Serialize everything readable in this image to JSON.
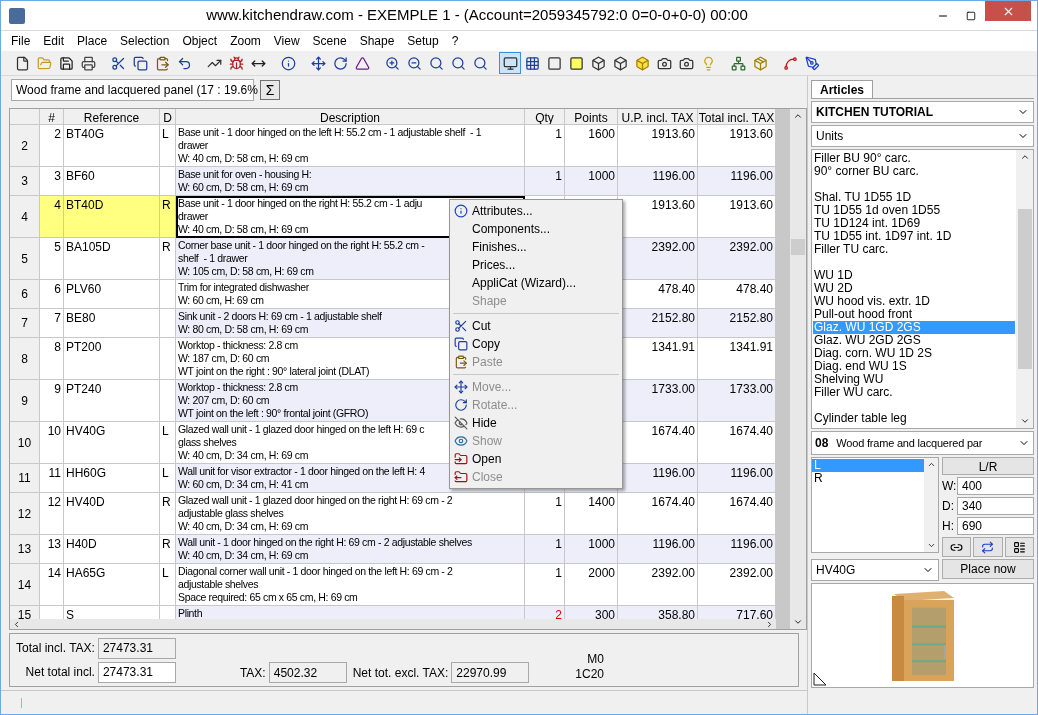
{
  "window": {
    "title": "www.kitchendraw.com - EXEMPLE 1 - (Account=2059345792:0 0=0-0+0-0) 00:00"
  },
  "menu": [
    "File",
    "Edit",
    "Place",
    "Selection",
    "Object",
    "Zoom",
    "View",
    "Scene",
    "Shape",
    "Setup",
    "?"
  ],
  "toolbar": [
    {
      "selected": false
    },
    {
      "selected": false
    },
    {
      "selected": false
    },
    {
      "selected": false
    },
    {
      "selected": false
    },
    {
      "selected": false
    },
    {
      "selected": false
    },
    {
      "selected": false
    },
    {
      "selected": false
    },
    {
      "selected": false
    },
    {
      "selected": false
    },
    {
      "selected": false
    },
    {
      "selected": false
    },
    {
      "selected": false
    },
    {
      "selected": false
    },
    {
      "selected": false
    },
    {
      "selected": false
    },
    {
      "selected": false
    },
    {
      "selected": false
    },
    {
      "selected": false
    },
    {
      "selected": true
    },
    {
      "selected": false
    },
    {
      "selected": false
    },
    {
      "selected": false
    },
    {
      "selected": false
    },
    {
      "selected": false
    },
    {
      "selected": false
    },
    {
      "selected": false
    },
    {
      "selected": false
    },
    {
      "selected": false
    },
    {
      "selected": false
    },
    {
      "selected": false
    },
    {
      "selected": false
    },
    {
      "selected": false
    }
  ],
  "finish_select": {
    "value": "Wood frame and lacquered panel (17 : 19.6%"
  },
  "sum_button": "Σ",
  "table": {
    "columns": [
      "#",
      "Reference",
      "D",
      "Description",
      "Qty",
      "Points",
      "U.P. incl. TAX",
      "Total incl. TAX"
    ],
    "rows": [
      {
        "header": "2",
        "num": "2",
        "ref": "BT40G",
        "d": "L",
        "desc": [
          "Base unit - 1 door hinged on the left H: 55.2 cm - 1 adjustable shelf  - 1",
          "drawer",
          "W: 40 cm, D: 58 cm, H: 69 cm"
        ],
        "qty": "1",
        "points": "1600",
        "up": "1913.60",
        "total": "1913.60",
        "selected": false,
        "qty_alert": false
      },
      {
        "header": "3",
        "num": "3",
        "ref": "BF60",
        "d": "",
        "desc": [
          "Base unit for oven - housing H:",
          "W: 60 cm, D: 58 cm, H: 69 cm"
        ],
        "qty": "1",
        "points": "1000",
        "up": "1196.00",
        "total": "1196.00",
        "selected": false,
        "qty_alert": false
      },
      {
        "header": "4",
        "num": "4",
        "ref": "BT40D",
        "d": "R",
        "desc": [
          "Base unit - 1 door hinged on the right H: 55.2 cm - 1 adju",
          "drawer",
          "W: 40 cm, D: 58 cm, H: 69 cm"
        ],
        "up": "1913.60",
        "total": "1913.60",
        "selected": true
      },
      {
        "header": "5",
        "num": "5",
        "ref": "BA105D",
        "d": "R",
        "desc": [
          "Corner base unit - 1 door hinged on the right H: 55.2 cm -",
          "shelf  - 1 drawer",
          "W: 105 cm, D: 58 cm, H: 69 cm"
        ],
        "up": "2392.00",
        "total": "2392.00",
        "selected": false
      },
      {
        "header": "6",
        "num": "6",
        "ref": "PLV60",
        "d": "",
        "desc": [
          "Trim for integrated dishwasher",
          "W: 60 cm, H: 69 cm"
        ],
        "up": "478.40",
        "total": "478.40",
        "selected": false
      },
      {
        "header": "7",
        "num": "7",
        "ref": "BE80",
        "d": "",
        "desc": [
          "Sink unit - 2 doors H: 69 cm - 1 adjustable shelf",
          "W: 80 cm, D: 58 cm, H: 69 cm"
        ],
        "up": "2152.80",
        "total": "2152.80",
        "selected": false
      },
      {
        "header": "8",
        "num": "8",
        "ref": "PT200",
        "d": "",
        "desc": [
          "Worktop - thickness: 2.8 cm",
          "W: 187 cm, D: 60 cm",
          "WT joint on the right : 90° lateral joint (DLAT)"
        ],
        "up": "1341.91",
        "total": "1341.91",
        "selected": false
      },
      {
        "header": "9",
        "num": "9",
        "ref": "PT240",
        "d": "",
        "desc": [
          "Worktop - thickness: 2.8 cm",
          "W: 207 cm, D: 60 cm",
          "WT joint on the left : 90° frontal joint (GFRO)"
        ],
        "up": "1733.00",
        "total": "1733.00",
        "selected": false
      },
      {
        "header": "10",
        "num": "10",
        "ref": "HV40G",
        "d": "L",
        "desc": [
          "Glazed wall unit - 1 glazed door hinged on the left H: 69 c",
          "glass shelves",
          "W: 40 cm, D: 34 cm, H: 69 cm"
        ],
        "up": "1674.40",
        "total": "1674.40",
        "selected": false
      },
      {
        "header": "11",
        "num": "11",
        "ref": "HH60G",
        "d": "L",
        "desc": [
          "Wall unit for visor extractor - 1 door hinged on the left H: 4",
          "W: 60 cm, D: 34 cm, H: 41 cm"
        ],
        "up": "1196.00",
        "total": "1196.00",
        "selected": false
      },
      {
        "header": "12",
        "num": "12",
        "ref": "HV40D",
        "d": "R",
        "desc": [
          "Glazed wall unit - 1 glazed door hinged on the right H: 69 cm - 2",
          "adjustable glass shelves",
          "W: 40 cm, D: 34 cm, H: 69 cm"
        ],
        "qty": "1",
        "points": "1400",
        "up": "1674.40",
        "total": "1674.40",
        "selected": false,
        "qty_alert": false
      },
      {
        "header": "13",
        "num": "13",
        "ref": "H40D",
        "d": "R",
        "desc": [
          "Wall unit - 1 door hinged on the right H: 69 cm - 2 adjustable shelves",
          "W: 40 cm, D: 34 cm, H: 69 cm"
        ],
        "qty": "1",
        "points": "1000",
        "up": "1196.00",
        "total": "1196.00",
        "selected": false,
        "qty_alert": false
      },
      {
        "header": "14",
        "num": "14",
        "ref": "HA65G",
        "d": "L",
        "desc": [
          "Diagonal corner wall unit - 1 door hinged on the left H: 69 cm - 2",
          "adjustable shelves",
          "Space required: 65 cm x 65 cm, H: 69 cm"
        ],
        "qty": "1",
        "points": "2000",
        "up": "2392.00",
        "total": "2392.00",
        "selected": false,
        "qty_alert": false
      },
      {
        "header": "15",
        "num": "",
        "ref": "S",
        "d": "",
        "desc": [
          "Plinth"
        ],
        "qty": "2",
        "points": "300",
        "up": "358.80",
        "total": "717.60",
        "selected": false,
        "qty_alert": true
      }
    ]
  },
  "context_menu": [
    {
      "kind": "item",
      "label": "Attributes...",
      "disabled": false
    },
    {
      "kind": "item",
      "label": "Components...",
      "disabled": false
    },
    {
      "kind": "item",
      "label": "Finishes...",
      "disabled": false
    },
    {
      "kind": "item",
      "label": "Prices...",
      "disabled": false
    },
    {
      "kind": "item",
      "label": "AppliCat (Wizard)...",
      "disabled": false
    },
    {
      "kind": "item",
      "label": "Shape",
      "disabled": true
    },
    {
      "kind": "separator"
    },
    {
      "kind": "item",
      "label": "Cut",
      "disabled": false
    },
    {
      "kind": "item",
      "label": "Copy",
      "disabled": false
    },
    {
      "kind": "item",
      "label": "Paste",
      "disabled": true
    },
    {
      "kind": "separator"
    },
    {
      "kind": "item",
      "label": "Move...",
      "disabled": true
    },
    {
      "kind": "item",
      "label": "Rotate...",
      "disabled": true
    },
    {
      "kind": "item",
      "label": "Hide",
      "disabled": false
    },
    {
      "kind": "item",
      "label": "Show",
      "disabled": true
    },
    {
      "kind": "item",
      "label": "Open",
      "disabled": false
    },
    {
      "kind": "item",
      "label": "Close",
      "disabled": true
    }
  ],
  "totals": {
    "total_incl_label": "Total incl. TAX:",
    "total_incl": "27473.31",
    "net_total_label": "Net total incl.",
    "net_total": "27473.31",
    "tax_label": "TAX:",
    "tax": "4502.32",
    "net_excl_label": "Net tot. excl. TAX:",
    "net_excl": "22970.99",
    "code_1": "M0",
    "code_2": "1C20"
  },
  "sidebar": {
    "tabs": [
      {
        "label": "Articles",
        "selected": true
      }
    ],
    "catalog": "KITCHEN TUTORIAL",
    "category": "Units",
    "items": [
      {
        "kind": "item",
        "label": "Filler BU 90° carc.",
        "selected": false
      },
      {
        "kind": "item",
        "label": "90° corner BU carc.",
        "selected": false
      },
      {
        "kind": "spacer"
      },
      {
        "kind": "item",
        "label": "Shal. TU 1D55 1D",
        "selected": false
      },
      {
        "kind": "item",
        "label": "TU 1D55 1d oven 1D55",
        "selected": false
      },
      {
        "kind": "item",
        "label": "TU 1D124 int. 1D69",
        "selected": false
      },
      {
        "kind": "item",
        "label": "TU 1D55 int. 1D97 int. 1D",
        "selected": false
      },
      {
        "kind": "item",
        "label": "Filler TU carc.",
        "selected": false
      },
      {
        "kind": "spacer"
      },
      {
        "kind": "item",
        "label": "WU 1D",
        "selected": false
      },
      {
        "kind": "item",
        "label": "WU 2D",
        "selected": false
      },
      {
        "kind": "item",
        "label": "WU hood vis. extr. 1D",
        "selected": false
      },
      {
        "kind": "item",
        "label": "Pull-out hood front",
        "selected": false
      },
      {
        "kind": "item",
        "label": "Glaz. WU 1GD 2GS",
        "selected": true
      },
      {
        "kind": "item",
        "label": "Glaz. WU 2GD 2GS",
        "selected": false
      },
      {
        "kind": "item",
        "label": "Diag. corn. WU 1D 2S",
        "selected": false
      },
      {
        "kind": "item",
        "label": "Diag. end WU 1S",
        "selected": false
      },
      {
        "kind": "item",
        "label": "Shelving WU",
        "selected": false
      },
      {
        "kind": "item",
        "label": "Filler WU carc.",
        "selected": false
      },
      {
        "kind": "spacer"
      },
      {
        "kind": "item",
        "label": "Cylinder table leg",
        "selected": false
      }
    ],
    "finish_code": "08",
    "finish_name": "Wood frame and lacquered par",
    "hinges": [
      {
        "label": "L",
        "selected": true
      },
      {
        "label": "R",
        "selected": false
      }
    ],
    "lr_button": "L/R",
    "dims": [
      {
        "label": "W:",
        "value": "400"
      },
      {
        "label": "D:",
        "value": "340"
      },
      {
        "label": "H:",
        "value": "690"
      }
    ],
    "reference": "HV40G",
    "place_button": "Place now"
  }
}
